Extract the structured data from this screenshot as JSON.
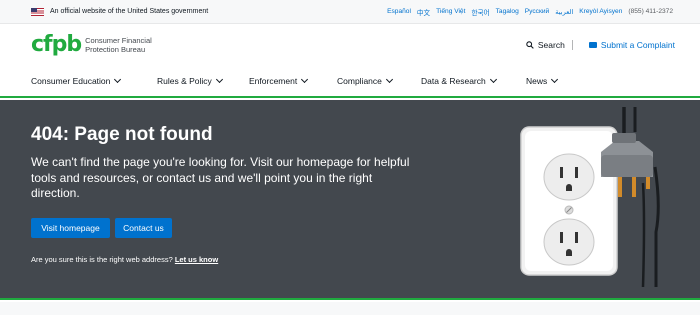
{
  "gov_banner": {
    "official_text": "An official website of the United States government",
    "languages": [
      "Español",
      "中文",
      "Tiếng Việt",
      "한국어",
      "Tagalog",
      "Русский",
      "العربية",
      "Kreyòl Ayisyen"
    ],
    "phone": "(855) 411-2372"
  },
  "header": {
    "logo_mark": "cfpb",
    "logo_line1": "Consumer Financial",
    "logo_line2": "Protection Bureau",
    "search_label": "Search",
    "complaint_label": "Submit a Complaint"
  },
  "nav": {
    "items": [
      {
        "label": "Consumer Education"
      },
      {
        "label": "Rules & Policy"
      },
      {
        "label": "Enforcement"
      },
      {
        "label": "Compliance"
      },
      {
        "label": "Data & Research"
      },
      {
        "label": "News"
      }
    ]
  },
  "hero": {
    "title": "404: Page not found",
    "text": "We can't find the page you're looking for. Visit our homepage for helpful tools and resources, or contact us and we'll point you in the right direction.",
    "btn_home": "Visit homepage",
    "btn_contact": "Contact us",
    "address_question": "Are you sure this is the right web address?",
    "address_link": "Let us know"
  },
  "colors": {
    "brand_green": "#20aa3f",
    "link_blue": "#0072ce",
    "hero_bg": "#43484e"
  },
  "icons": {
    "flag": "us-flag-icon",
    "search": "search-icon",
    "complaint": "complaint-icon",
    "chevron": "chevron-down-icon",
    "illustration": "outlet-plug-illustration"
  }
}
